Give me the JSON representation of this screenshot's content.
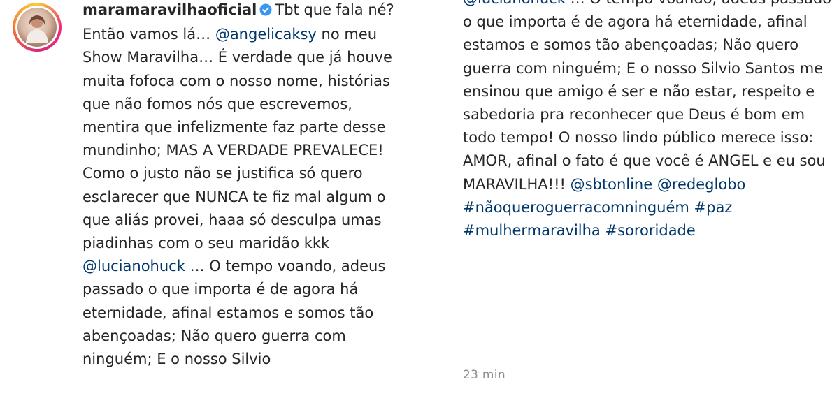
{
  "post": {
    "username": "maramaravilhaoficial",
    "verified_icon": "verified-badge-icon",
    "accent_color": "#3897f0",
    "link_color": "#00376b",
    "left_caption": {
      "text1": "Tbt que fala né? Então vamos lá… ",
      "mention1": "@angelicaksy",
      "text2": " no meu Show Maravilha… É verdade que já houve muita fofoca com o nosso nome, histórias que não fomos nós que escrevemos, mentira que infelizmente faz parte desse mundinho; MAS A VERDADE PREVALECE! Como o justo não se justifica só quero esclarecer que NUNCA te fiz mal algum o que aliás provei, haaa só desculpa umas piadinhas com o seu maridão kkk ",
      "mention2": "@lucianohuck",
      "text3": " … O tempo voando, adeus passado o que importa é de agora há eternidade, afinal estamos e somos tão abençoadas; Não quero guerra com ninguém; E o nosso Silvio"
    },
    "right_caption": {
      "mention1": "@lucianohuck",
      "text1": " … O tempo voando, adeus passado o que importa é de agora há eternidade, afinal estamos e somos tão abençoadas; Não quero guerra com ninguém; E o nosso Silvio Santos me ensinou que amigo é ser e não estar, respeito e sabedoria pra reconhecer que Deus é bom em todo tempo! O nosso lindo público merece isso: AMOR, afinal o fato é que você é ANGEL e eu sou MARAVILHA!!! ",
      "mention2": "@sbtonline",
      "mention3": "@redeglobo",
      "hashtag1": "#nãoqueroguerracomninguém",
      "hashtag2": "#paz",
      "hashtag3": "#mulhermaravilha",
      "hashtag4": "#sororidade"
    },
    "timestamp": "23 min"
  }
}
